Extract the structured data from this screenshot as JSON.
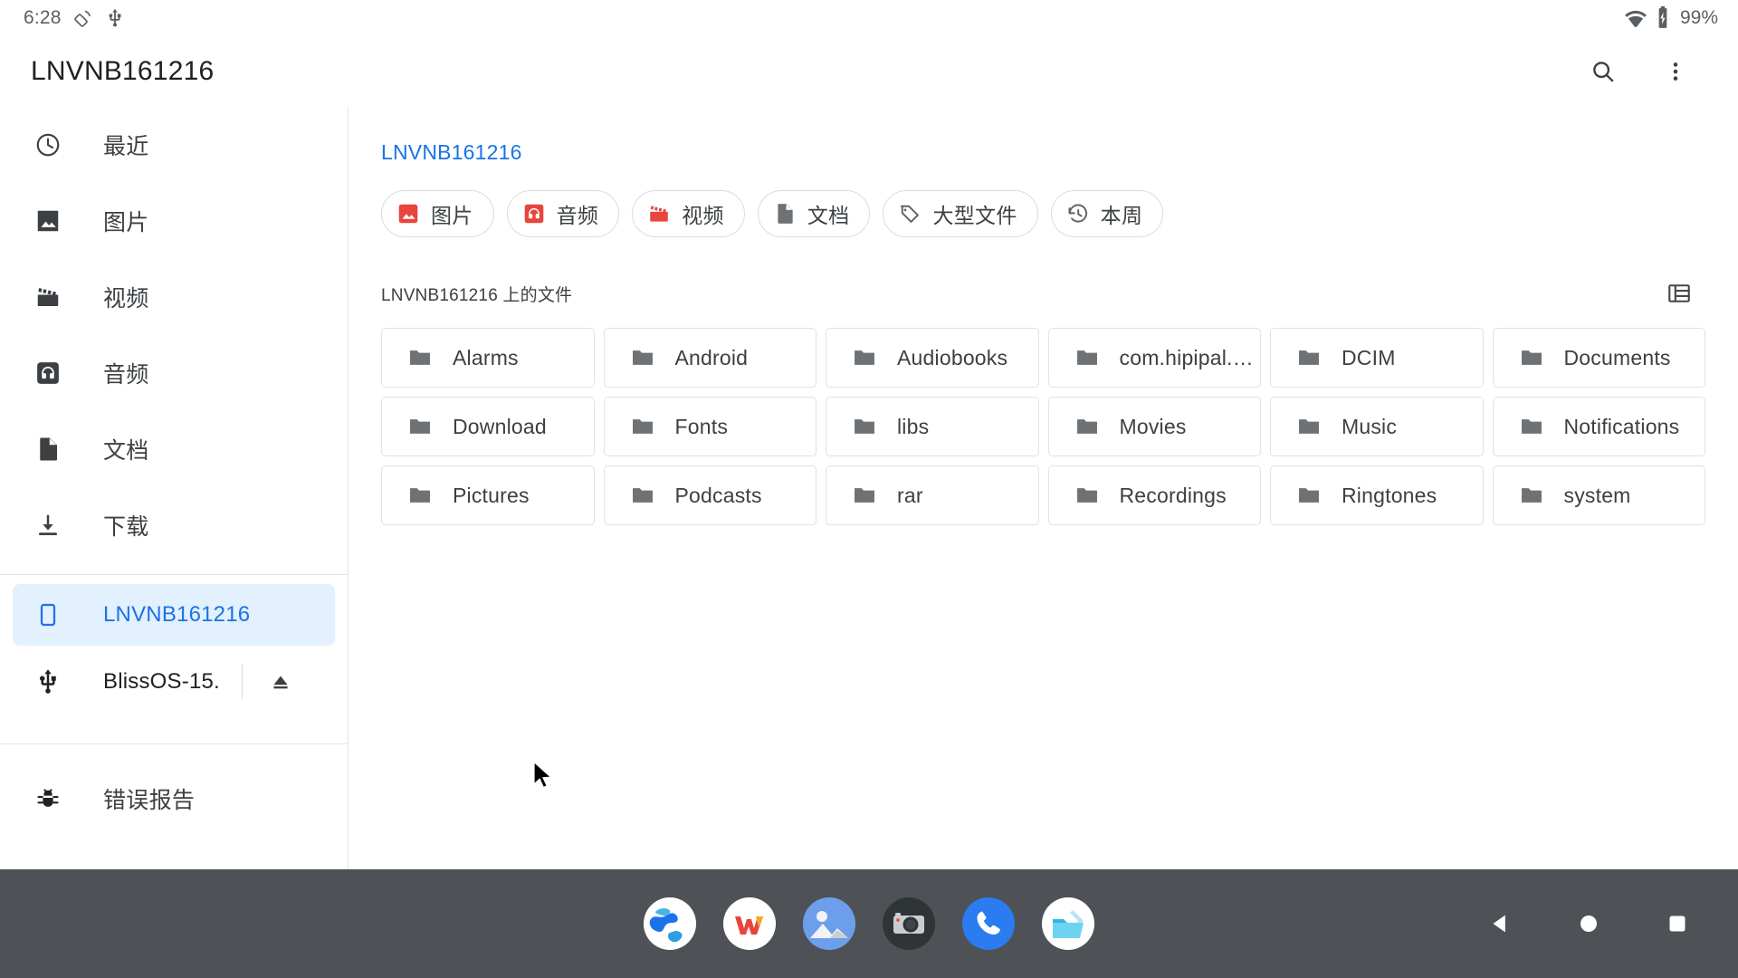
{
  "status_bar": {
    "time": "6:28",
    "icons": [
      "auto-rotate-icon",
      "usb-icon"
    ],
    "wifi_icon": "wifi-icon",
    "battery_icon": "battery-charging-icon",
    "battery_text": "99%"
  },
  "app_bar": {
    "title": "LNVNB161216",
    "search_label": "search-icon",
    "overflow_label": "more-options-icon"
  },
  "sidebar": {
    "items": [
      {
        "label": "最近",
        "icon": "clock-icon"
      },
      {
        "label": "图片",
        "icon": "image-icon"
      },
      {
        "label": "视频",
        "icon": "movie-icon"
      },
      {
        "label": "音频",
        "icon": "headset-icon"
      },
      {
        "label": "文档",
        "icon": "document-icon"
      },
      {
        "label": "下载",
        "icon": "download-icon"
      }
    ],
    "devices": [
      {
        "label": "LNVNB161216",
        "icon": "phone-icon",
        "selected": true
      },
      {
        "label": "BlissOS-15.",
        "icon": "usb-icon",
        "selected": false,
        "eject": "eject-icon"
      }
    ],
    "footer": {
      "label": "错误报告",
      "icon": "bug-icon"
    }
  },
  "content": {
    "breadcrumb": "LNVNB161216",
    "chips": [
      {
        "label": "图片",
        "icon": "image-icon",
        "color": "#e8453c"
      },
      {
        "label": "音频",
        "icon": "headset-icon",
        "color": "#e8453c"
      },
      {
        "label": "视频",
        "icon": "movie-icon",
        "color": "#e8453c"
      },
      {
        "label": "文档",
        "icon": "document-icon",
        "color": "#6e7275"
      },
      {
        "label": "大型文件",
        "icon": "tag-icon",
        "color": "#5f6368"
      },
      {
        "label": "本周",
        "icon": "history-icon",
        "color": "#5f6368"
      }
    ],
    "section_title": "LNVNB161216 上的文件",
    "view_toggle_icon": "list-view-icon",
    "folders": [
      "Alarms",
      "Android",
      "Audiobooks",
      "com.hipipal.q…",
      "DCIM",
      "Documents",
      "Download",
      "Fonts",
      "libs",
      "Movies",
      "Music",
      "Notifications",
      "Pictures",
      "Podcasts",
      "rar",
      "Recordings",
      "Ringtones",
      "system"
    ]
  },
  "taskbar": {
    "apps": [
      {
        "name": "browser-app-icon"
      },
      {
        "name": "wps-office-app-icon"
      },
      {
        "name": "gallery-app-icon"
      },
      {
        "name": "camera-app-icon"
      },
      {
        "name": "phone-app-icon"
      },
      {
        "name": "files-app-icon"
      }
    ],
    "nav": [
      {
        "name": "back-button"
      },
      {
        "name": "home-button"
      },
      {
        "name": "recents-button"
      }
    ]
  },
  "colors": {
    "accent": "#1a73e8",
    "accent_bg": "#e3f0fd",
    "red": "#e8453c",
    "taskbar_bg": "#4e5256",
    "text": "#3c4043"
  }
}
